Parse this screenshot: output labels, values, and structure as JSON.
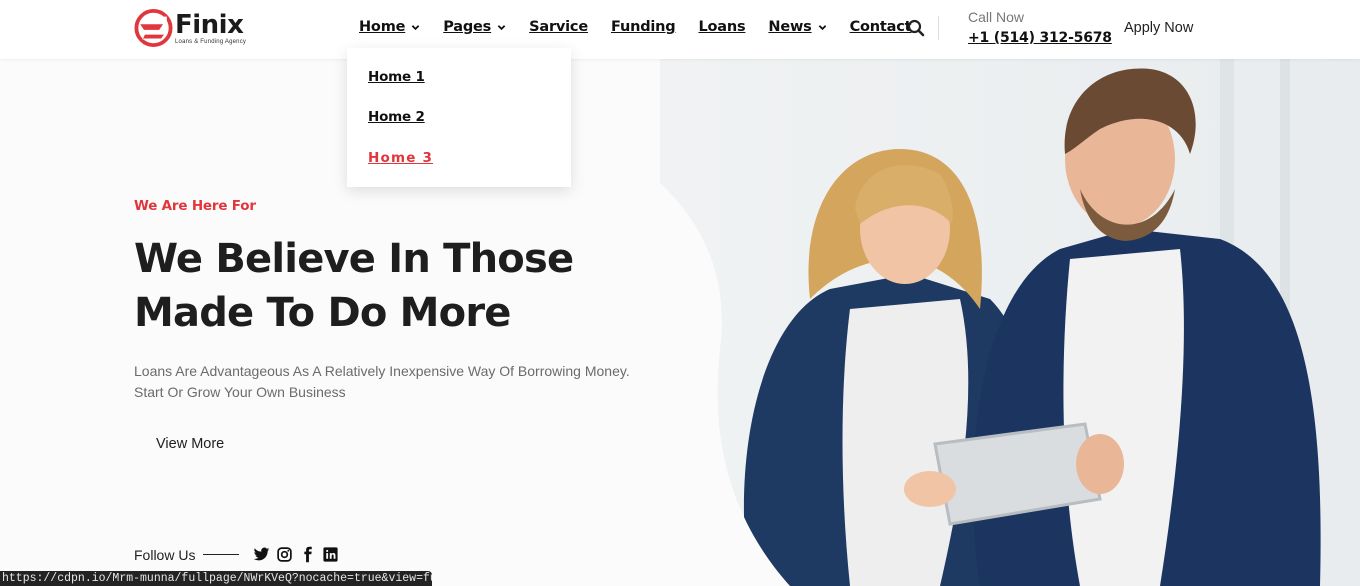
{
  "brand": {
    "name": "Finix",
    "tagline": "Loans & Funding Agency",
    "accent": "#e0363c"
  },
  "nav": {
    "items": [
      {
        "label": "Home",
        "has_dropdown": true
      },
      {
        "label": "Pages",
        "has_dropdown": true
      },
      {
        "label": "Sarvice",
        "has_dropdown": false
      },
      {
        "label": "Funding",
        "has_dropdown": false
      },
      {
        "label": "Loans",
        "has_dropdown": false
      },
      {
        "label": "News",
        "has_dropdown": true
      },
      {
        "label": "Contact",
        "has_dropdown": false
      }
    ],
    "search_icon": "search-icon",
    "call_label": "Call Now",
    "call_phone": "+1 (514) 312-5678",
    "apply_label": "Apply Now"
  },
  "home_dropdown": {
    "items": [
      {
        "label": "Home 1",
        "active": false
      },
      {
        "label": "Home 2",
        "active": false
      },
      {
        "label": "Home 3",
        "active": true
      }
    ]
  },
  "hero": {
    "eyebrow": "We Are Here For",
    "headline_line1": "We Believe In Those",
    "headline_line2": "Made To Do More",
    "description_line1": "Loans Are Advantageous As A Relatively Inexpensive Way Of Borrowing Money.",
    "description_line2": "Start Or Grow Your Own Business",
    "cta_label": "View More"
  },
  "follow": {
    "label": "Follow Us",
    "icons": [
      "twitter-icon",
      "instagram-icon",
      "facebook-icon",
      "linkedin-icon"
    ]
  },
  "status_bar": {
    "url": "https://cdpn.io/Mrm-munna/fullpage/NWrKVeQ?nocache=true&view=fullpage#"
  }
}
